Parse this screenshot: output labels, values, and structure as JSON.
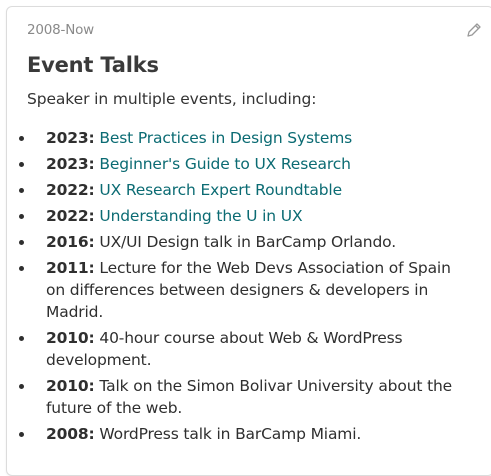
{
  "card": {
    "date_range": "2008-Now",
    "title": "Event Talks",
    "subtitle": "Speaker in multiple events, including:",
    "edit_icon": "pencil-icon"
  },
  "events": [
    {
      "year": "2023:",
      "text": "Best Practices in Design Systems",
      "is_link": true
    },
    {
      "year": "2023:",
      "text": "Beginner's Guide to UX Research",
      "is_link": true
    },
    {
      "year": "2022:",
      "text": "UX Research Expert Roundtable",
      "is_link": true
    },
    {
      "year": "2022:",
      "text": "Understanding the U in UX",
      "is_link": true
    },
    {
      "year": "2016:",
      "text": "UX/UI Design talk in BarCamp Orlando.",
      "is_link": false
    },
    {
      "year": "2011:",
      "text": "Lecture for the Web Devs Association of Spain on differences between designers & developers in Madrid.",
      "is_link": false
    },
    {
      "year": "2010:",
      "text": "40-hour course about Web & WordPress development.",
      "is_link": false
    },
    {
      "year": "2010:",
      "text": "Talk on the Simon Bolivar University about the future of the web.",
      "is_link": false
    },
    {
      "year": "2008:",
      "text": "WordPress talk in BarCamp Miami.",
      "is_link": false
    }
  ],
  "colors": {
    "link": "#0b6b73",
    "text": "#2f2f2f",
    "muted": "#8a8a8a",
    "border": "#dcdcdc"
  }
}
